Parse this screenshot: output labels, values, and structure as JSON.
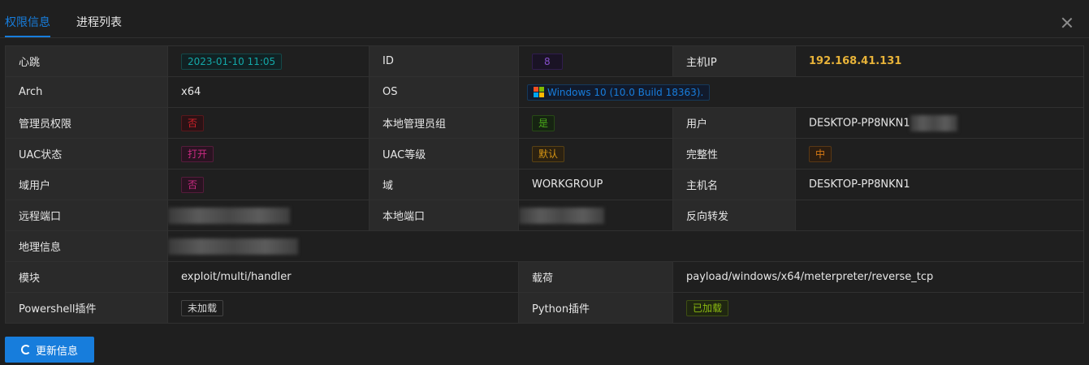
{
  "tabs": [
    {
      "label": "权限信息",
      "active": true
    },
    {
      "label": "进程列表",
      "active": false
    }
  ],
  "rows": {
    "heartbeat": {
      "label": "心跳",
      "value": "2023-01-10 11:05"
    },
    "id": {
      "label": "ID",
      "value": "8"
    },
    "host_ip": {
      "label": "主机IP",
      "value": "192.168.41.131"
    },
    "arch": {
      "label": "Arch",
      "value": "x64"
    },
    "os": {
      "label": "OS",
      "value": "Windows 10 (10.0 Build 18363)."
    },
    "admin": {
      "label": "管理员权限",
      "value": "否"
    },
    "local_admin_group": {
      "label": "本地管理员组",
      "value": "是"
    },
    "user": {
      "label": "用户",
      "value": "DESKTOP-PP8NKN1"
    },
    "uac_status": {
      "label": "UAC状态",
      "value": "打开"
    },
    "uac_level": {
      "label": "UAC等级",
      "value": "默认"
    },
    "integrity": {
      "label": "完整性",
      "value": "中"
    },
    "domain_user": {
      "label": "域用户",
      "value": "否"
    },
    "domain": {
      "label": "域",
      "value": "WORKGROUP"
    },
    "hostname": {
      "label": "主机名",
      "value": "DESKTOP-PP8NKN1"
    },
    "remote_port": {
      "label": "远程端口"
    },
    "local_port": {
      "label": "本地端口"
    },
    "reverse_forward": {
      "label": "反向转发",
      "value": ""
    },
    "geo": {
      "label": "地理信息"
    },
    "module": {
      "label": "模块",
      "value": "exploit/multi/handler"
    },
    "payload": {
      "label": "载荷",
      "value": "payload/windows/x64/meterpreter/reverse_tcp"
    },
    "powershell": {
      "label": "Powershell插件",
      "value": "未加载"
    },
    "python": {
      "label": "Python插件",
      "value": "已加载"
    }
  },
  "update_button": {
    "label": "更新信息",
    "icon": "refresh-icon"
  },
  "colors": {
    "accent": "#177ddc",
    "ip": "#e8b339"
  }
}
